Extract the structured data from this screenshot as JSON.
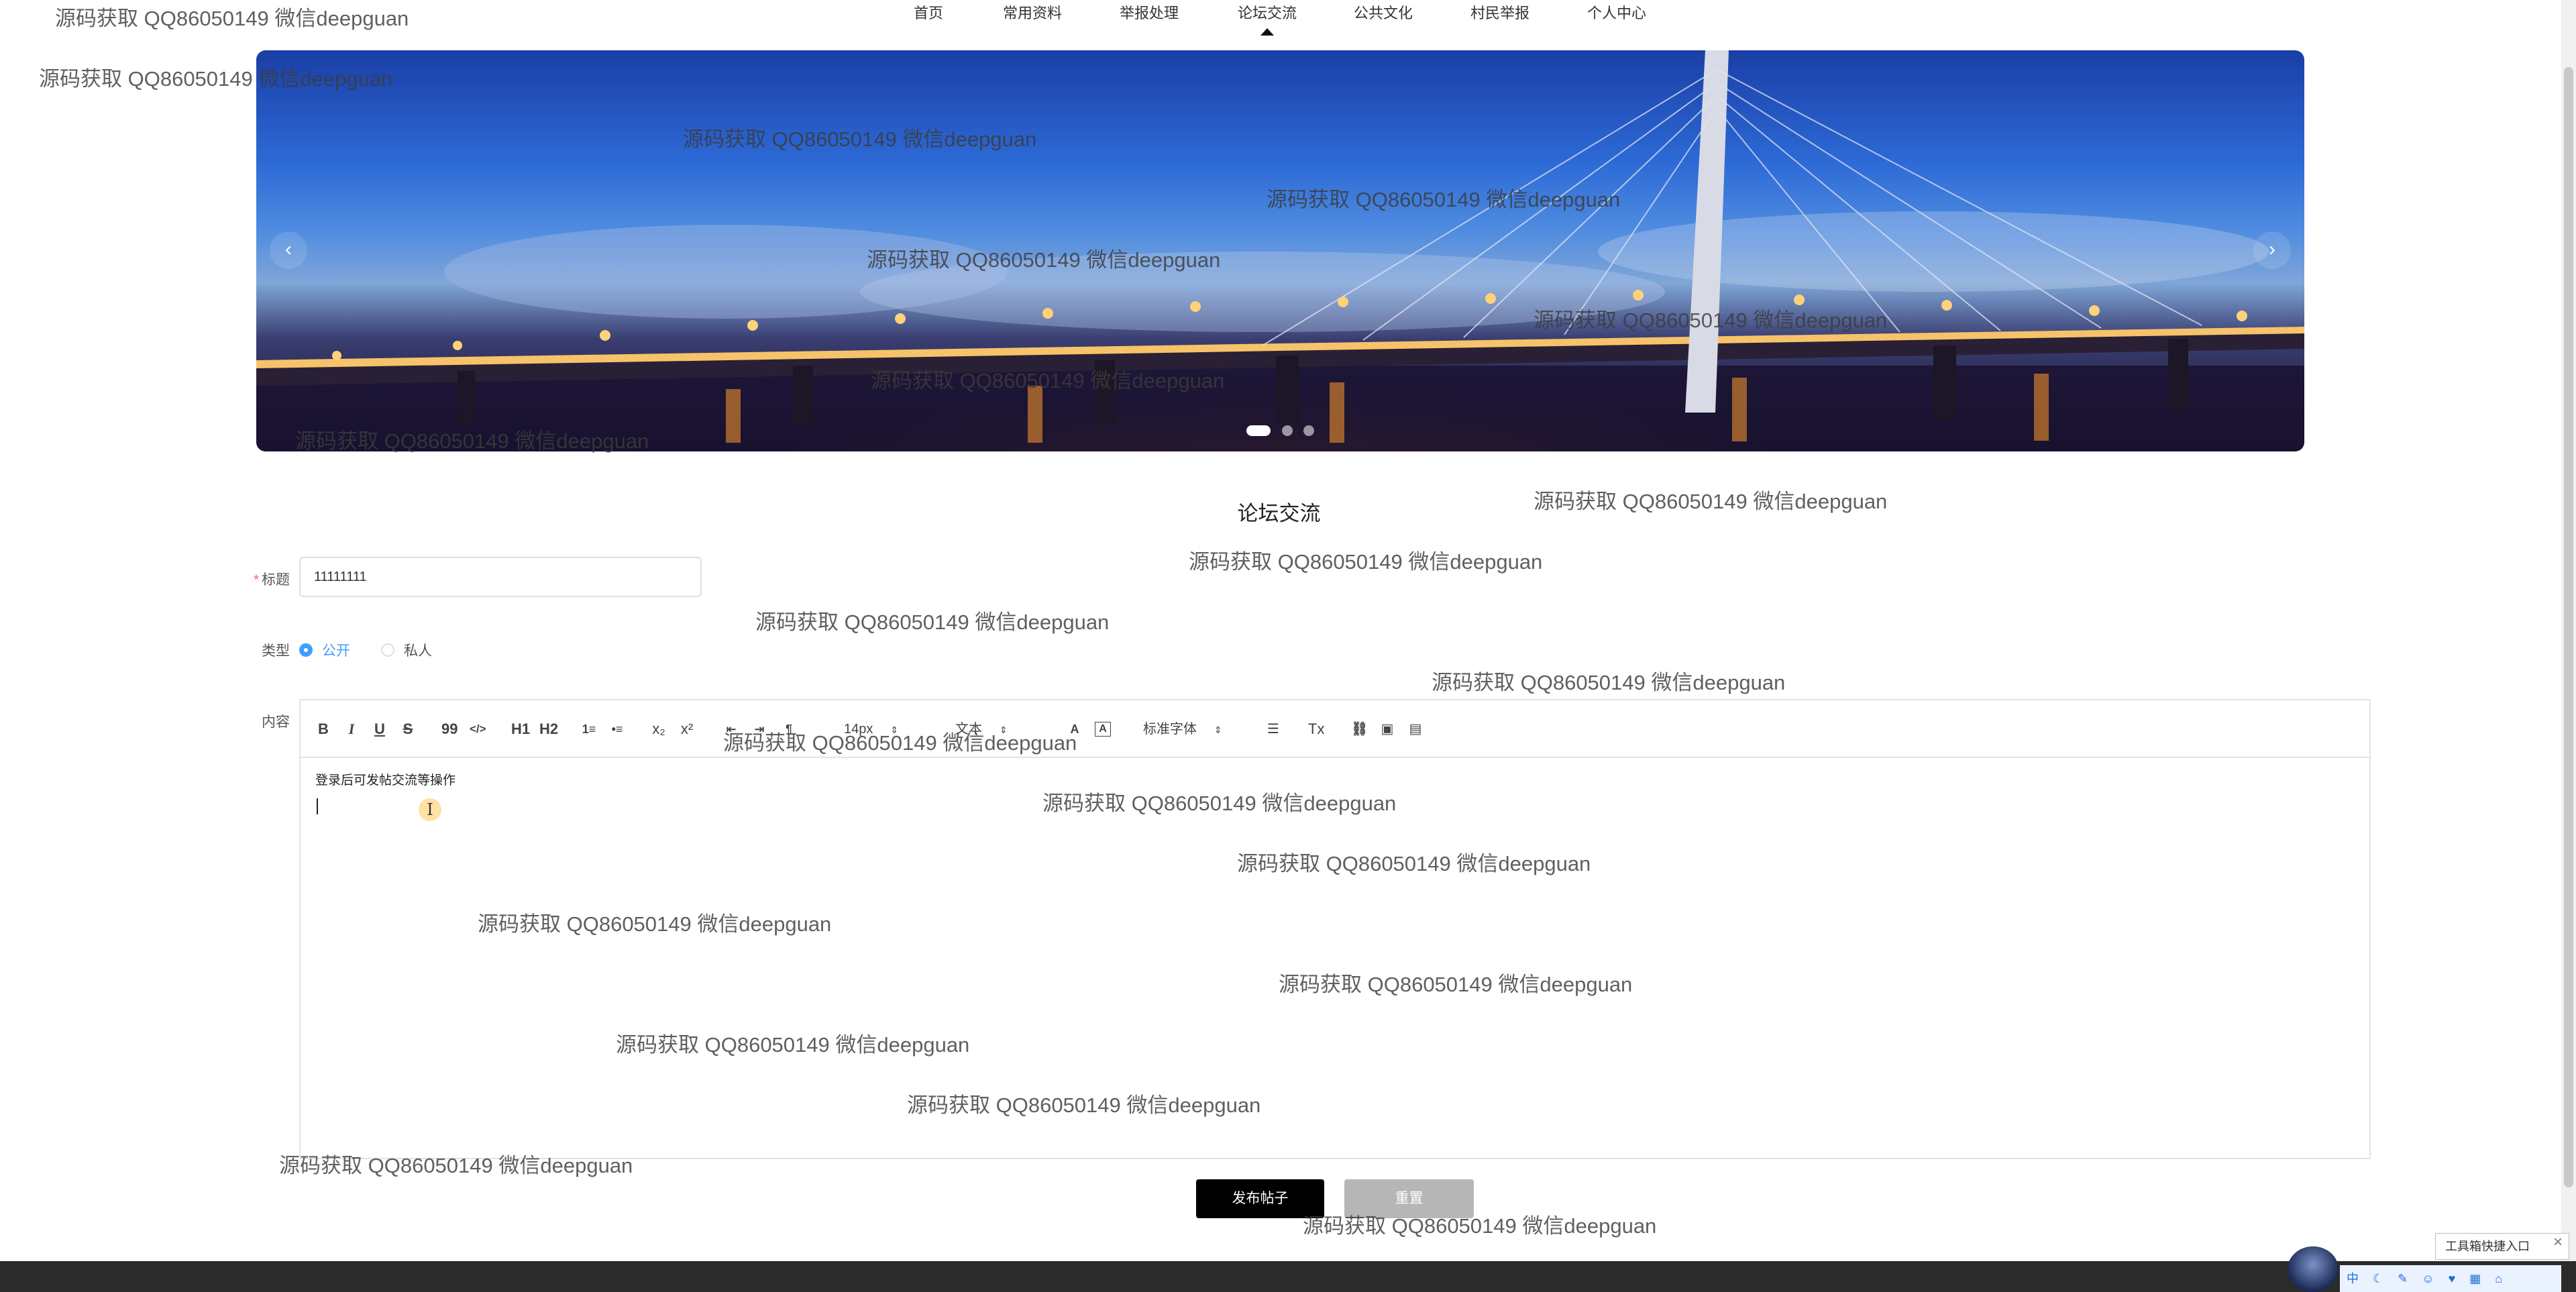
{
  "nav": {
    "items": [
      "首页",
      "常用资料",
      "举报处理",
      "论坛交流",
      "公共文化",
      "村民举报",
      "个人中心"
    ],
    "active": "论坛交流"
  },
  "banner": {
    "prev_icon": "chevron-left-icon",
    "next_icon": "chevron-right-icon",
    "prev_glyph": "‹",
    "next_glyph": "›",
    "slides": 3,
    "active_slide": 1
  },
  "section": {
    "title": "论坛交流"
  },
  "form": {
    "title_label": "标题",
    "required_mark": "*",
    "title_value": "11111111",
    "type_label": "类型",
    "type_options": [
      "公开",
      "私人"
    ],
    "type_selected": "公开",
    "content_label": "内容",
    "content_text": "登录后可发帖交流等操作"
  },
  "toolbar": {
    "bold": "B",
    "italic": "I",
    "underline": "U",
    "strike": "S",
    "quote": "99",
    "code": "</>",
    "h1": "H1",
    "h2": "H2",
    "ordered": "1≡",
    "bullet": "•≡",
    "sub": "x₂",
    "sup": "x²",
    "size_select": "14px",
    "header_select": "文本",
    "font_select": "标准字体",
    "select_arrow": "⇕",
    "clean": "Tx"
  },
  "buttons": {
    "submit": "发布帖子",
    "reset": "重置"
  },
  "widget": {
    "title": "工具箱快捷入口",
    "close": "×",
    "icons": "中 ☾ ✎ ☺ ♥ ▦ ⌂"
  },
  "watermark": "源码获取 QQ86050149 微信deepguan",
  "colors": {
    "accent": "#409eff",
    "submit_bg": "#000000",
    "reset_bg": "#b6b6b6",
    "footer": "#2b2b2b"
  }
}
